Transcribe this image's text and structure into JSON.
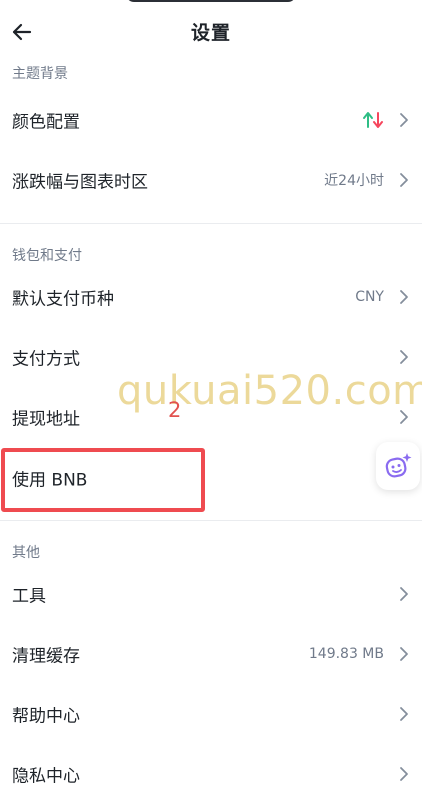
{
  "header": {
    "title": "设置"
  },
  "sections": {
    "theme": {
      "title": "主题背景",
      "items": [
        {
          "label": "颜色配置",
          "value": ""
        },
        {
          "label": "涨跌幅与图表时区",
          "value": "近24小时"
        }
      ]
    },
    "wallet": {
      "title": "钱包和支付",
      "items": [
        {
          "label": "默认支付币种",
          "value": "CNY"
        },
        {
          "label": "支付方式",
          "value": ""
        },
        {
          "label": "提现地址",
          "value": ""
        },
        {
          "label": "使用 BNB",
          "value": ""
        }
      ]
    },
    "other": {
      "title": "其他",
      "items": [
        {
          "label": "工具",
          "value": ""
        },
        {
          "label": "清理缓存",
          "value": "149.83 MB"
        },
        {
          "label": "帮助中心",
          "value": ""
        },
        {
          "label": "隐私中心",
          "value": ""
        }
      ]
    }
  },
  "annotations": {
    "watermark": "qukuai520.com",
    "step_number": "2"
  },
  "colors": {
    "up": "#2ebd85",
    "down": "#f6465d",
    "highlight": "#ef4b50",
    "assistant": "#8a6bf0"
  },
  "icons": {
    "back": "arrow-left-icon",
    "chevron": "chevron-right-icon",
    "color_config": "up-down-arrows-icon",
    "assistant": "ai-assistant-icon"
  }
}
